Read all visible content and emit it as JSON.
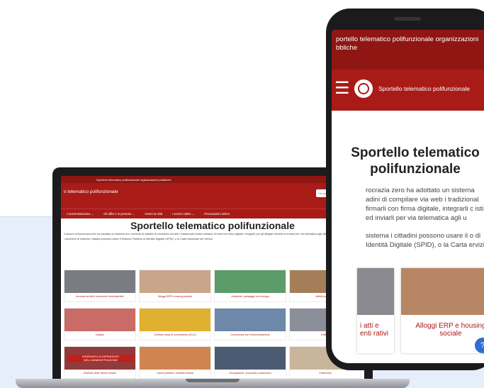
{
  "laptop": {
    "topbar": "Sportello telematico polifunzionale organizzazioni pubbliche",
    "header_title": "o telematico polifunzionale",
    "header_sub": "",
    "search_placeholder": "Cerca...",
    "nav": [
      "L'amministrazione ⌄",
      "Gli uffici e le persone ⌄",
      "Vivere la città",
      "I servizi online ⌄",
      "Prenotazioni online"
    ],
    "title": "Sportello telematico polifunzionale",
    "para1": "Comune di Burocrazia zero ha adottato un sistema che consente ai cittadini di compilare via web i tradizionali moduli cartacei, firmarli con firma digitale, integrarli con gli allegati richiesti ed inviarli per via telematica agli uffici competenti.",
    "para2": "r accedere al sistema i cittadini possono usare il Sistema Pubblico di Identità Digitale (SPID), o la Carta Nazionale dei Servizi.",
    "cards": [
      {
        "label": "Accesso ad atti e documenti amministrativi",
        "color": "#7b7b82"
      },
      {
        "label": "Alloggi ERP e housing sociale",
        "color": "#c9a58a"
      },
      {
        "label": "Ambiente, paesaggio ed ecologia",
        "color": "#5d9b6a"
      },
      {
        "label": "Attività produttive",
        "color": "#a47e59"
      },
      {
        "label": "Catasto",
        "color": "#c96b66"
      },
      {
        "label": "Centrale unica di committenza (CUC)",
        "color": "#e0b030"
      },
      {
        "label": "Comunicare con l'Amministrazione",
        "color": "#6d88a8"
      },
      {
        "label": "Edilizia",
        "color": "#8a8f99"
      },
      {
        "label": "Gestione delle risorse umane",
        "color": "#913b3b"
      },
      {
        "label": "Lavori pubblici e mobilità urbana",
        "color": "#d08550"
      },
      {
        "label": "Occupazione, economia e assunzioni",
        "color": "#4b5b72"
      },
      {
        "label": "Patrimonio",
        "color": "#c9b59a"
      }
    ],
    "reserved_banner": "RISERVATO AI DIPENDENTI DELL'AMMINISTRAZIONE"
  },
  "phone": {
    "topbar": "portello telematico polifunzionale organizzazioni bbliche",
    "header_title": "Sportello telematico polifunzionale",
    "title": "Sportello telematico polifunzionale",
    "para1": "rocrazia zero ha adottato un sistema adini di compilare via web i tradizional firmarli con firma digitale, integrarli c isti ed inviarli per via telematica agli u",
    "para2": "sistema i cittadini possono usare il o di Identità Digitale (SPID), o la Carta ervizi.",
    "cards": [
      {
        "label": "i atti e enti rativi",
        "color": "#8a8a90"
      },
      {
        "label": "Alloggi ERP e housing sociale",
        "color": "#b78664"
      }
    ],
    "chat_icon": "?"
  },
  "colors": {
    "brand_red": "#a91b17",
    "brand_dark_red": "#8f1613",
    "bg_blue": "#e7eefb"
  }
}
